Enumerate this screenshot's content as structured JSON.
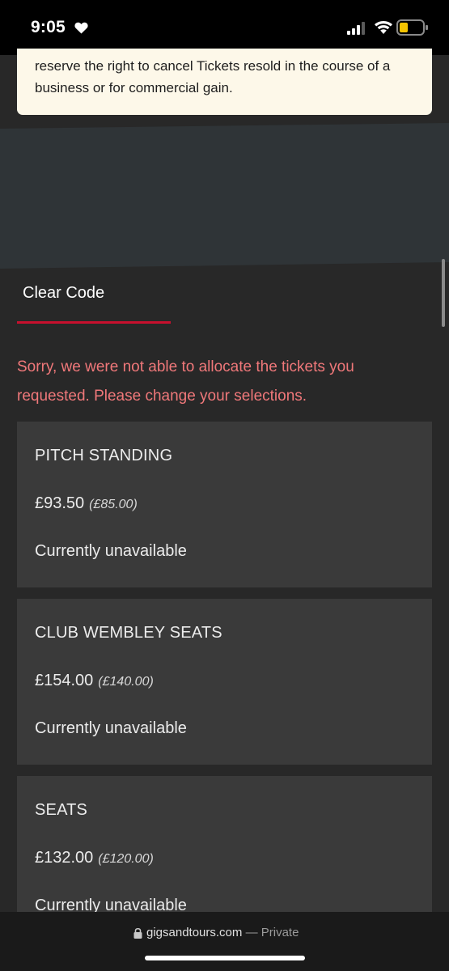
{
  "status_bar": {
    "time": "9:05"
  },
  "notice": {
    "text": "reserve the right to cancel Tickets resold in the course of a business or for commercial gain."
  },
  "clear_code": {
    "label": "Clear Code"
  },
  "error": {
    "message": "Sorry, we were not able to allocate the tickets you requested. Please change your selections."
  },
  "tickets": [
    {
      "name": "PITCH STANDING",
      "price": "£93.50",
      "base_price": "(£85.00)",
      "status": "Currently unavailable"
    },
    {
      "name": "CLUB WEMBLEY SEATS",
      "price": "£154.00",
      "base_price": "(£140.00)",
      "status": "Currently unavailable"
    },
    {
      "name": "SEATS",
      "price": "£132.00",
      "base_price": "(£120.00)",
      "status": "Currently unavailable"
    }
  ],
  "browser": {
    "domain": "gigsandtours.com",
    "separator": "—",
    "mode": "Private"
  },
  "colors": {
    "accent": "#c8102e",
    "error": "#f0787a",
    "card": "#3a3a3a",
    "notice_bg": "#fdf8e9"
  }
}
